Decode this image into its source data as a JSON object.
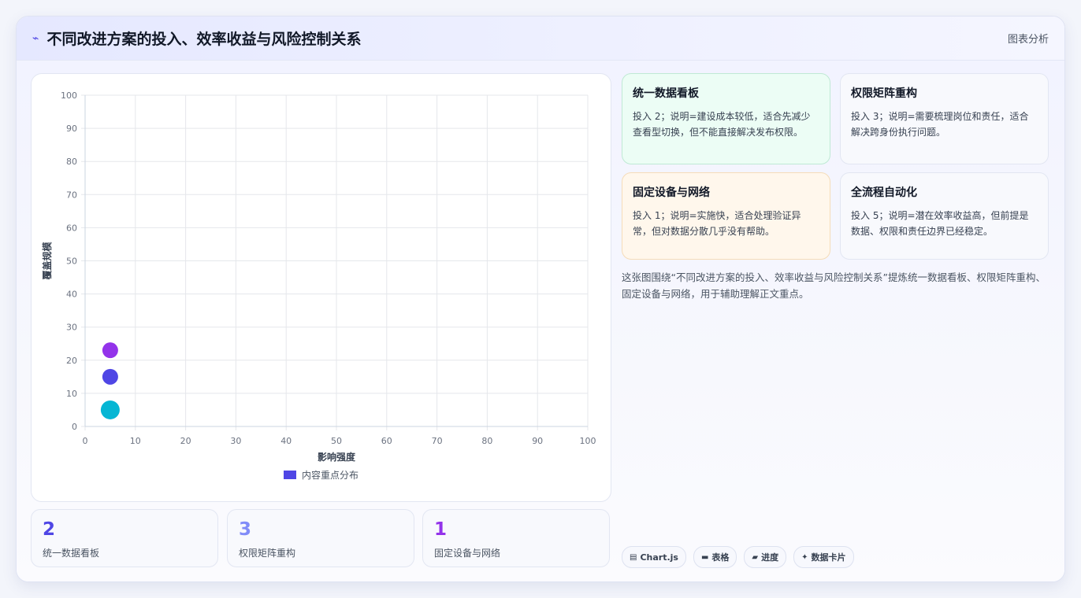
{
  "header": {
    "icon": "lightning-icon",
    "title": "不同改进方案的投入、效率收益与风险控制关系",
    "tag": "图表分析"
  },
  "chart_data": {
    "type": "scatter",
    "xlabel": "影响强度",
    "ylabel": "覆盖规模",
    "xlim": [
      0,
      100
    ],
    "ylim": [
      0,
      100
    ],
    "xticks": [
      "0",
      "10",
      "20",
      "30",
      "40",
      "50",
      "60",
      "70",
      "80",
      "90",
      "100"
    ],
    "yticks": [
      "0",
      "10",
      "20",
      "30",
      "40",
      "50",
      "60",
      "70",
      "80",
      "90",
      "100"
    ],
    "grid": true,
    "legend_position": "bottom",
    "series": [
      {
        "name": "内容重点分布",
        "legend_color": "#4f46e5",
        "points": [
          {
            "x": 5,
            "y": 23,
            "color": "#9333ea"
          },
          {
            "x": 5,
            "y": 15,
            "color": "#4f46e5"
          },
          {
            "x": 5,
            "y": 5,
            "color": "#06b6d4"
          }
        ]
      }
    ]
  },
  "stats": [
    {
      "value": "2",
      "label": "统一数据看板",
      "color": "#4f46e5"
    },
    {
      "value": "3",
      "label": "权限矩阵重构",
      "color": "#818cf8"
    },
    {
      "value": "1",
      "label": "固定设备与网络",
      "color": "#9333ea"
    }
  ],
  "cards": [
    {
      "title": "统一数据看板",
      "text": "投入 2；说明=建设成本较低，适合先减少查看型切换，但不能直接解决发布权限。",
      "bg": "#ecfdf5",
      "border": "#bfe9d4"
    },
    {
      "title": "权限矩阵重构",
      "text": "投入 3；说明=需要梳理岗位和责任，适合解决跨身份执行问题。",
      "bg": "#f8f9fd",
      "border": "#e2e6f2"
    },
    {
      "title": "固定设备与网络",
      "text": "投入 1；说明=实施快，适合处理验证异常，但对数据分散几乎没有帮助。",
      "bg": "#fff7ec",
      "border": "#f5dcb8"
    },
    {
      "title": "全流程自动化",
      "text": "投入 5；说明=潜在效率收益高，但前提是数据、权限和责任边界已经稳定。",
      "bg": "#f8f9fd",
      "border": "#e2e6f2"
    }
  ],
  "description": "这张图围绕“不同改进方案的投入、效率收益与风险控制关系”提炼统一数据看板、权限矩阵重构、固定设备与网络，用于辅助理解正文重点。",
  "chips": [
    {
      "icon": "chart-icon",
      "glyph": "▤",
      "label": "Chart.js"
    },
    {
      "icon": "table-icon",
      "glyph": "▬",
      "label": "表格"
    },
    {
      "icon": "progress-icon",
      "glyph": "▰",
      "label": "进度"
    },
    {
      "icon": "sparkle-icon",
      "glyph": "✦",
      "label": "数据卡片"
    }
  ]
}
